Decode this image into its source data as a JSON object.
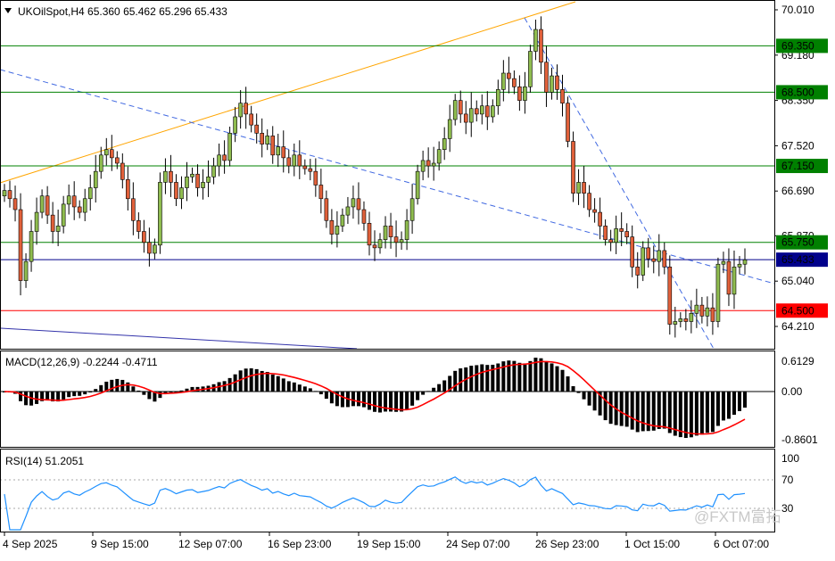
{
  "chart_data": [
    {
      "type": "candlestick",
      "symbol": "UKOilSpot",
      "timeframe": "H4",
      "ohlc_header": "UKOilSpot,H4  65.360 65.462 65.296 65.433",
      "ylim": [
        64.0,
        70.1
      ],
      "y_ticks": [
        "70.010",
        "69.180",
        "68.350",
        "67.520",
        "66.690",
        "65.870",
        "65.040",
        "64.210"
      ],
      "time_labels": [
        "4 Sep 2025",
        "9 Sep 15:00",
        "12 Sep 07:00",
        "16 Sep 23:00",
        "19 Sep 15:00",
        "24 Sep 07:00",
        "26 Sep 23:00",
        "1 Oct 15:00",
        "6 Oct 07:00"
      ],
      "closes": [
        66.7,
        66.55,
        66.35,
        65.05,
        65.4,
        65.95,
        66.3,
        66.6,
        66.25,
        65.95,
        66.05,
        66.45,
        66.6,
        66.4,
        66.3,
        66.55,
        66.75,
        67.05,
        67.35,
        67.45,
        67.3,
        67.2,
        66.9,
        66.55,
        66.15,
        65.95,
        65.75,
        65.55,
        65.7,
        66.85,
        67.05,
        66.85,
        66.55,
        66.75,
        66.95,
        67.0,
        66.75,
        66.85,
        66.95,
        67.15,
        67.35,
        67.25,
        67.75,
        68.05,
        68.3,
        68.1,
        67.9,
        67.75,
        67.55,
        67.7,
        67.35,
        67.5,
        67.3,
        67.15,
        67.35,
        67.15,
        67.1,
        67.05,
        66.8,
        66.55,
        66.15,
        65.9,
        66.05,
        66.25,
        66.4,
        66.55,
        66.35,
        66.1,
        65.7,
        65.65,
        65.8,
        66.05,
        65.85,
        65.75,
        65.8,
        66.15,
        66.55,
        67.05,
        67.25,
        67.15,
        67.2,
        67.45,
        67.65,
        68.0,
        68.35,
        68.1,
        67.95,
        68.2,
        68.1,
        68.25,
        68.05,
        68.25,
        68.55,
        68.85,
        68.75,
        68.6,
        68.35,
        68.6,
        69.25,
        69.65,
        69.05,
        68.5,
        68.8,
        68.55,
        68.3,
        67.6,
        66.65,
        66.85,
        66.65,
        66.35,
        66.3,
        66.05,
        65.8,
        65.75,
        66.0,
        65.95,
        65.85,
        65.3,
        65.15,
        65.65,
        65.45,
        65.4,
        65.6,
        65.3,
        64.25,
        64.3,
        64.35,
        64.3,
        64.45,
        64.6,
        64.4,
        64.55,
        64.3,
        65.35,
        65.4,
        64.8,
        65.3,
        65.35,
        65.43
      ],
      "horizontal_levels": [
        {
          "label": "69.350",
          "value": 69.35,
          "color": "#008000"
        },
        {
          "label": "68.500",
          "value": 68.5,
          "color": "#008000"
        },
        {
          "label": "67.150",
          "value": 67.15,
          "color": "#008000"
        },
        {
          "label": "65.750",
          "value": 65.75,
          "color": "#008000"
        },
        {
          "label": "65.433",
          "value": 65.433,
          "color": "#00008b"
        },
        {
          "label": "64.500",
          "value": 64.5,
          "color": "#ff0000"
        }
      ],
      "trendlines": [
        {
          "name": "upper-channel",
          "color": "#ffa500",
          "dashed": false
        },
        {
          "name": "descending-dashed",
          "color": "#4169e1",
          "dashed": true
        },
        {
          "name": "steep-dashed",
          "color": "#4169e1",
          "dashed": true
        },
        {
          "name": "lower-solid",
          "color": "#3333aa",
          "dashed": false
        }
      ],
      "colors": {
        "up": "#8fbc4f",
        "down": "#e0603a",
        "wick": "#000000"
      }
    },
    {
      "type": "histogram",
      "indicator": "MACD",
      "header": "MACD(12,26,9) -0.2244 -0.4711",
      "y_ticks": [
        "0.6129",
        "0.00",
        "-0.8601"
      ],
      "ylim": [
        -0.8601,
        0.6129
      ],
      "signal_color": "#ff0000"
    },
    {
      "type": "line",
      "indicator": "RSI",
      "header": "RSI(14) 51.2051",
      "y_ticks": [
        "100",
        "70",
        "30"
      ],
      "ylim": [
        0,
        100
      ],
      "levels": [
        70,
        30
      ],
      "line_color": "#1e90ff"
    }
  ],
  "watermark": "@FXTM富拓"
}
